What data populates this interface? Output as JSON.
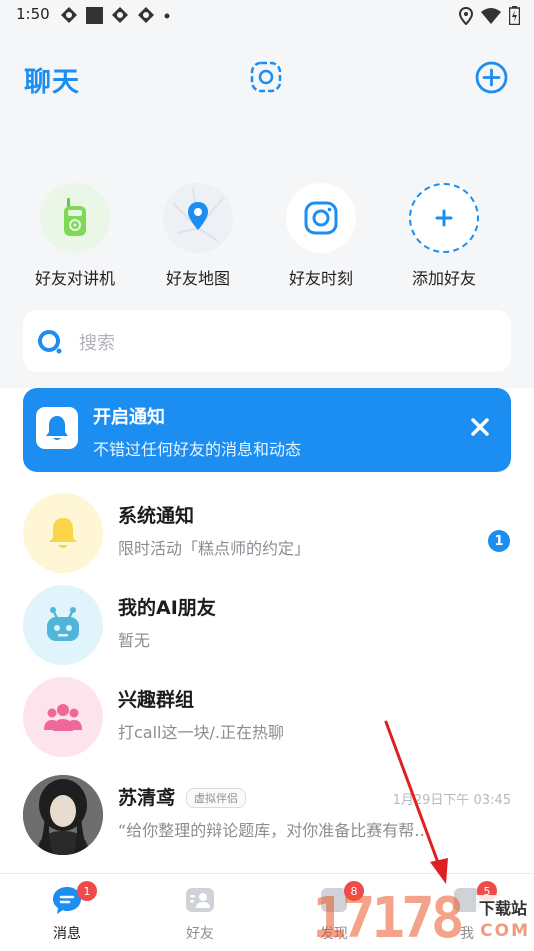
{
  "status_bar": {
    "time": "1:50"
  },
  "header": {
    "title": "聊天"
  },
  "quick_actions": [
    {
      "label": "好友对讲机",
      "icon": "walkie-talkie-icon"
    },
    {
      "label": "好友地图",
      "icon": "map-pin-icon"
    },
    {
      "label": "好友时刻",
      "icon": "camera-moment-icon"
    },
    {
      "label": "添加好友",
      "icon": "plus-icon"
    }
  ],
  "search": {
    "placeholder": "搜索"
  },
  "banner": {
    "title": "开启通知",
    "subtitle": "不错过任何好友的消息和动态"
  },
  "chats": [
    {
      "name": "系统通知",
      "preview": "限时活动「糕点师的约定」",
      "unread": "1"
    },
    {
      "name": "我的AI朋友",
      "preview": "暂无"
    },
    {
      "name": "兴趣群组",
      "preview": "打call这一块/.正在热聊"
    },
    {
      "name": "苏清鸢",
      "tag": "虚拟伴侣",
      "time": "1月29日下午 03:45",
      "preview": "“给你整理的辩论题库，对你准备比赛有帮…"
    }
  ],
  "nav": [
    {
      "label": "消息",
      "badge": "1",
      "active": true
    },
    {
      "label": "好友"
    },
    {
      "label": "发现",
      "badge": "8"
    },
    {
      "label": "我",
      "badge": "5"
    }
  ],
  "watermark": {
    "digits": "17178",
    "site": "下载站",
    "domain": "COM"
  },
  "colors": {
    "accent": "#1c8ef2",
    "badge_red": "#f04a4a",
    "background": "#f5f6f8"
  }
}
